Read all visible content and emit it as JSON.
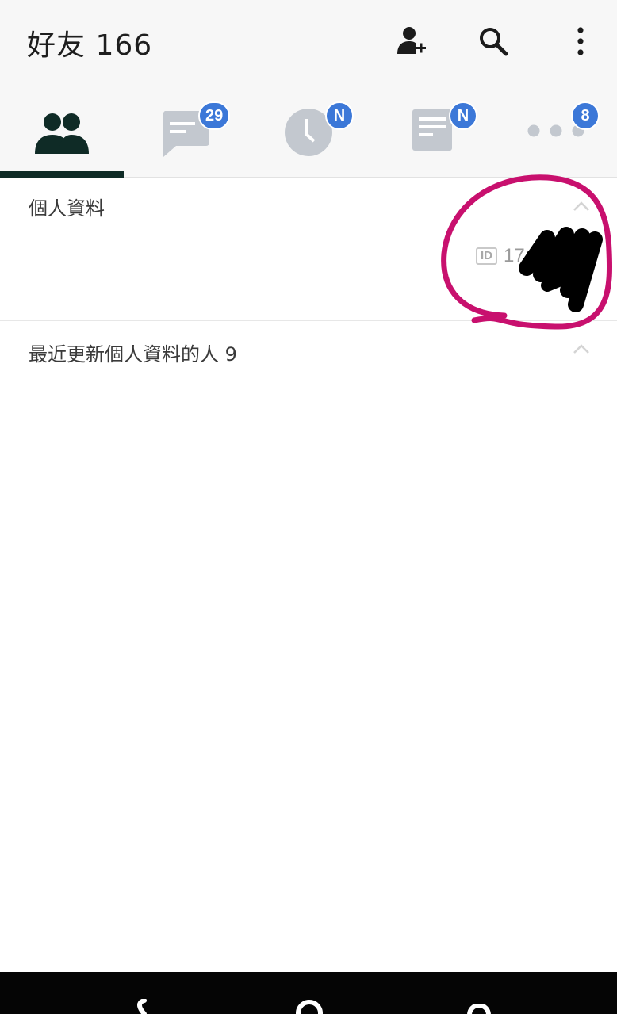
{
  "header": {
    "title": "好友 166",
    "icons": [
      "add-friend-icon",
      "search-icon",
      "more-vert-icon"
    ]
  },
  "tabs": [
    {
      "name": "friends",
      "icon": "friends-icon",
      "badge": "",
      "active": true
    },
    {
      "name": "chats",
      "icon": "chat-icon",
      "badge": "29"
    },
    {
      "name": "timeline",
      "icon": "clock-icon",
      "badge": "N"
    },
    {
      "name": "news",
      "icon": "news-icon",
      "badge": "N"
    },
    {
      "name": "more",
      "icon": "more-horiz-icon",
      "badge": "8"
    }
  ],
  "sections": {
    "profile": {
      "title": "個人資料",
      "id_label": "ID",
      "id_value": "17"
    },
    "recent": {
      "title": "最近更新個人資料的人 9"
    }
  },
  "colors": {
    "accent": "#3c78d8",
    "active_tab_icon": "#0f2b26",
    "inactive_tab_icon": "#c3c8cf",
    "annotation": "#c8106e"
  }
}
